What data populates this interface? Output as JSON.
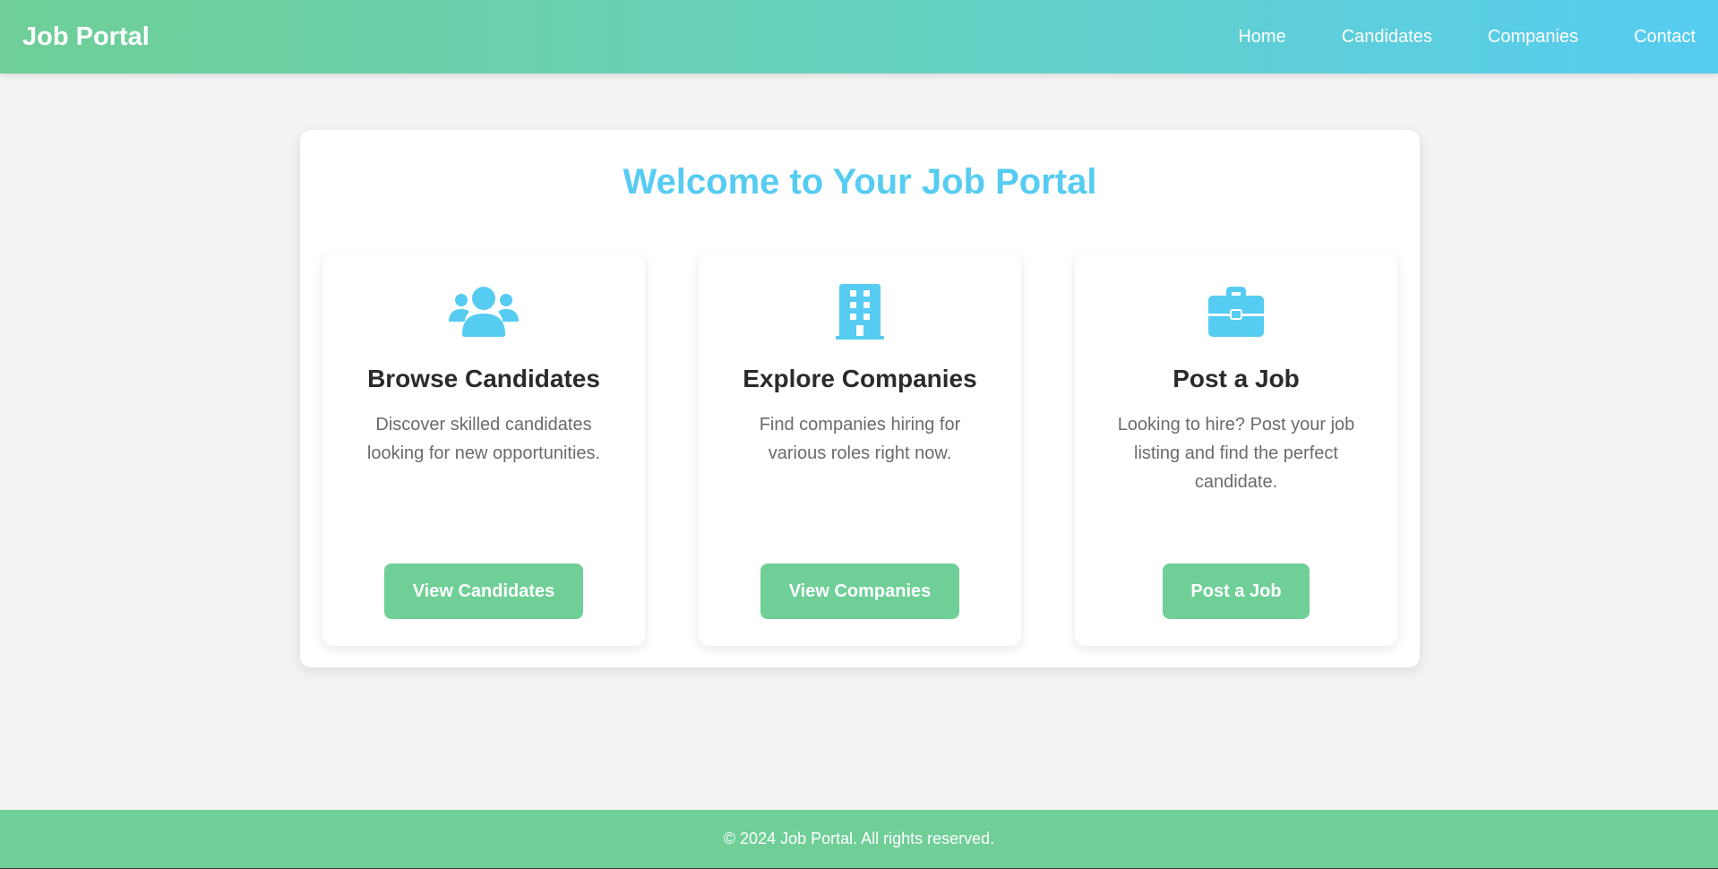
{
  "header": {
    "brand": "Job Portal",
    "nav": [
      "Home",
      "Candidates",
      "Companies",
      "Contact"
    ]
  },
  "main": {
    "title": "Welcome to Your Job Portal",
    "cards": [
      {
        "icon": "users-icon",
        "title": "Browse Candidates",
        "description": "Discover skilled candidates looking for new opportunities.",
        "button": "View Candidates"
      },
      {
        "icon": "building-icon",
        "title": "Explore Companies",
        "description": "Find companies hiring for various roles right now.",
        "button": "View Companies"
      },
      {
        "icon": "briefcase-icon",
        "title": "Post a Job",
        "description": "Looking to hire? Post your job listing and find the perfect candidate.",
        "button": "Post a Job"
      }
    ]
  },
  "footer": {
    "text": "© 2024 Job Portal. All rights reserved."
  },
  "colors": {
    "accent_blue": "#56ccf2",
    "accent_green": "#6fcf97",
    "background": "#f3f3f3"
  }
}
